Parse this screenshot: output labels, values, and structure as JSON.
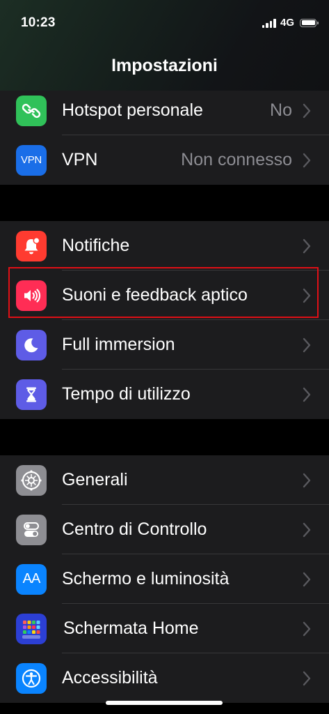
{
  "status": {
    "time": "10:23",
    "network": "4G"
  },
  "nav": {
    "title": "Impostazioni"
  },
  "groups": [
    {
      "items": [
        {
          "label": "Hotspot personale",
          "value": "No",
          "icon": "hotspot-link-icon",
          "color": "#30c159"
        },
        {
          "label": "VPN",
          "value": "Non connesso",
          "icon": "vpn-icon",
          "icon_text": "VPN",
          "color": "#1a6ee8"
        }
      ]
    },
    {
      "items": [
        {
          "label": "Notifiche",
          "value": "",
          "icon": "notification-bell-icon",
          "color": "#ff3b30"
        },
        {
          "label": "Suoni e feedback aptico",
          "value": "",
          "icon": "speaker-sound-icon",
          "color": "#ff2d55",
          "highlighted": true
        },
        {
          "label": "Full immersion",
          "value": "",
          "icon": "moon-icon",
          "color": "#5e5ce6"
        },
        {
          "label": "Tempo di utilizzo",
          "value": "",
          "icon": "hourglass-icon",
          "color": "#5e5ce6"
        }
      ]
    },
    {
      "items": [
        {
          "label": "Generali",
          "value": "",
          "icon": "gear-icon",
          "color": "#8e8e93"
        },
        {
          "label": "Centro di Controllo",
          "value": "",
          "icon": "toggles-icon",
          "color": "#8e8e93"
        },
        {
          "label": "Schermo e luminosità",
          "value": "",
          "icon": "text-size-icon",
          "icon_text": "AA",
          "color": "#0a84ff"
        },
        {
          "label": "Schermata Home",
          "value": "",
          "icon": "home-grid-icon",
          "color": "#2c3fd4"
        },
        {
          "label": "Accessibilità",
          "value": "",
          "icon": "accessibility-icon",
          "color": "#0a84ff"
        }
      ]
    }
  ],
  "colors": {
    "highlight": "#e00f16",
    "background": "#000000",
    "cell": "#1c1c1e",
    "secondary_text": "#8d8d93"
  }
}
